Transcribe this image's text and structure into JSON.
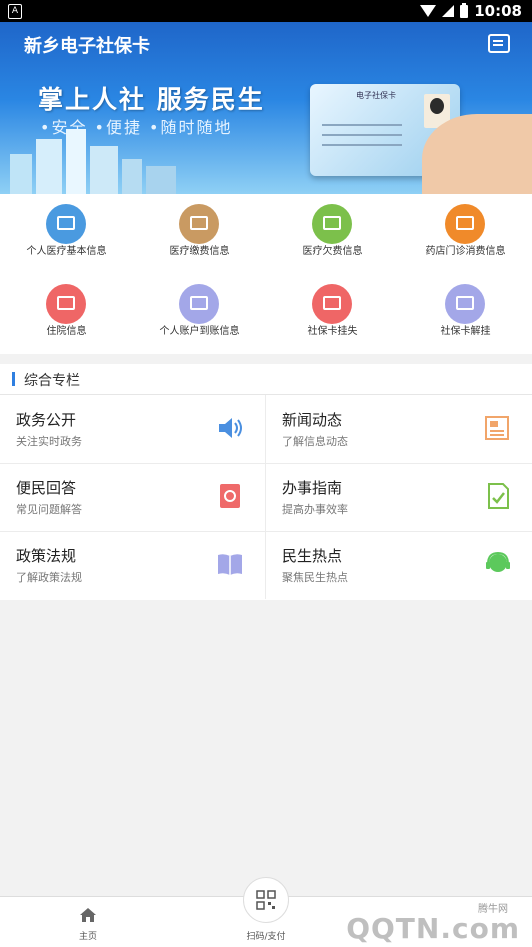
{
  "status_bar": {
    "time": "10:08",
    "left_badge": "A"
  },
  "header": {
    "app_title": "新乡电子社保卡"
  },
  "banner": {
    "slogan": "掌上人社 服务民生",
    "subline": "•安全 •便捷 •随时随地",
    "card_title": "电子社保卡"
  },
  "grid_items": [
    {
      "label": "个人医疗基本信息",
      "color": "#4a9ae0"
    },
    {
      "label": "医疗缴费信息",
      "color": "#c99a62"
    },
    {
      "label": "医疗欠费信息",
      "color": "#7cc04b"
    },
    {
      "label": "药店门诊消费信息",
      "color": "#f08a2a"
    },
    {
      "label": "住院信息",
      "color": "#ef6666"
    },
    {
      "label": "个人账户到账信息",
      "color": "#a3a7e8"
    },
    {
      "label": "社保卡挂失",
      "color": "#ef6666"
    },
    {
      "label": "社保卡解挂",
      "color": "#a3a7e8"
    }
  ],
  "section": {
    "title": "综合专栏"
  },
  "tiles": [
    {
      "title": "政务公开",
      "subtitle": "关注实时政务",
      "icon": "speaker-icon",
      "color": "#4a8fe0"
    },
    {
      "title": "新闻动态",
      "subtitle": "了解信息动态",
      "icon": "newspaper-icon",
      "color": "#f1a56a"
    },
    {
      "title": "便民回答",
      "subtitle": "常见问题解答",
      "icon": "address-book-icon",
      "color": "#ef6a6a"
    },
    {
      "title": "办事指南",
      "subtitle": "提高办事效率",
      "icon": "checklist-icon",
      "color": "#7cc04b"
    },
    {
      "title": "政策法规",
      "subtitle": "了解政策法规",
      "icon": "book-icon",
      "color": "#a3a7e8"
    },
    {
      "title": "民生热点",
      "subtitle": "聚焦民生热点",
      "icon": "headset-icon",
      "color": "#5cc95c"
    }
  ],
  "bottom_nav": {
    "home": "主页",
    "scan": "扫码/支付"
  },
  "watermark": {
    "brand": "腾牛网",
    "domain": "QQTN.com"
  }
}
